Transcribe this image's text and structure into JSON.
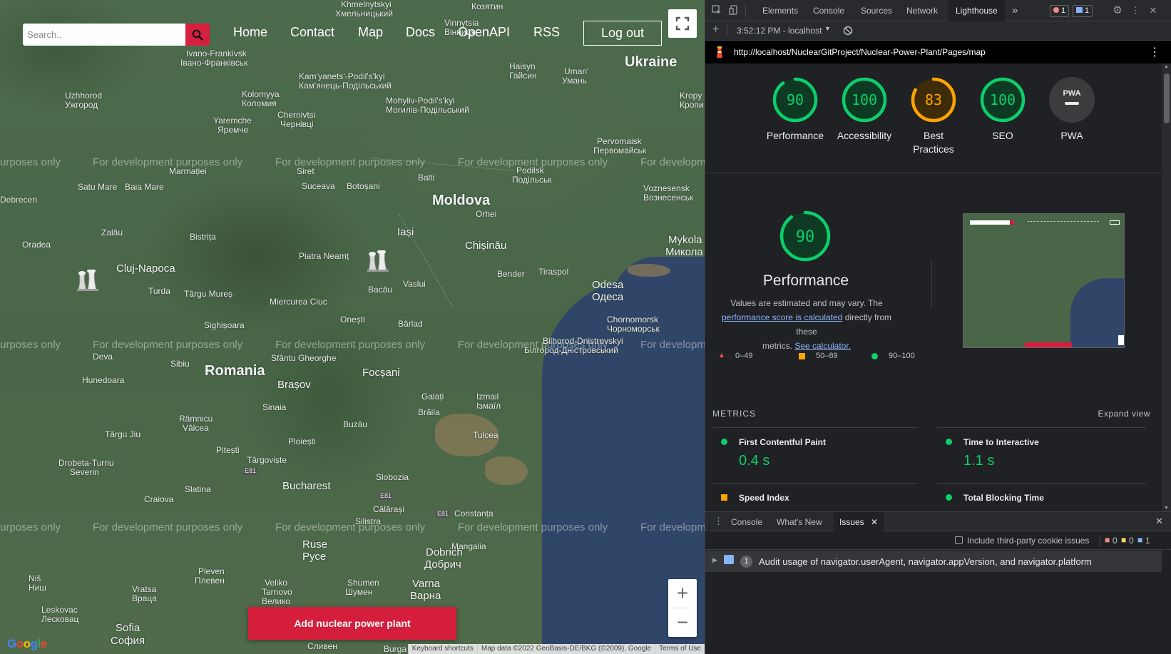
{
  "map": {
    "search_placeholder": "Search..",
    "nav": [
      "Home",
      "Contact",
      "Map",
      "Docs",
      "OpenAPI",
      "RSS"
    ],
    "logout_label": "Log out",
    "add_plant_label": "Add nuclear power plant",
    "watermark": "For development purposes only",
    "watermark_left": "urposes only",
    "watermark_right": "For developm",
    "zoom_in": "+",
    "zoom_out": "−",
    "google": "Google",
    "footer": [
      "Keyboard shortcuts",
      "Map data ©2022 GeoBasis-DE/BKG (©2009), Google",
      "Terms of Use"
    ],
    "labels": {
      "ukraine": "Ukraine",
      "moldova": "Moldova",
      "romania": "Romania",
      "cluj": "Cluj-Napoca",
      "chisinau": "Chișinău",
      "odesa": "Odesa",
      "odesa_cyr": "Одеса",
      "bucharest": "Bucharest",
      "brasov": "Brașov",
      "iasi": "Iași",
      "sofia": "Sofia",
      "sofia_cyr": "София",
      "constanta": "Constanța",
      "varna": "Varna",
      "varna_cyr": "Варна",
      "ivano": "Ivano-Frankivsk",
      "ivano_cyr": "Івано-Франківськ",
      "uzhhorod": "Uzhhorod",
      "uzhhorod_cyr": "Ужгород",
      "chernivtsi": "Chernivtsi",
      "chernivtsi_cyr": "Чернівці",
      "uman": "Uman'",
      "uman_cyr": "Умань",
      "kolomyya": "Kolomyya",
      "kolomyya_cyr": "Коломия",
      "kamyanets": "Kam'yanets'-Podil's'kyi",
      "kamyanets_cyr": "Кам'янець-Подільський",
      "mohyliv": "Mohyliv-Podil's'kyi",
      "mohyliv_cyr": "Могилів-Подільський",
      "khmelnytskyi": "Khmelnytskyi",
      "khmelnytskyi_cyr": "Хмельницький",
      "vinnytsia": "Vinnytsia",
      "vinnytsia_cyr": "Вінниця",
      "kozyatyn": "Козятин",
      "haisyn": "Haisyn",
      "haisyn_cyr": "Гайсин",
      "kropyv": "Kropy",
      "kropyv_cyr": "Кропи",
      "yaremche": "Yaremche",
      "yaremche_cyr": "Яремче",
      "pervomaisk": "Pervomaisk",
      "pervomaisk_cyr": "Первомайськ",
      "podilsk": "Podilsk",
      "podilsk_cyr": "Подільськ",
      "voznesensk": "Voznesensk",
      "voznesensk_cyr": "Вознесенськ",
      "mykola": "Mykola",
      "mykola_cyr": "Микола",
      "balti": "Balti",
      "orhei": "Orhei",
      "bender": "Bender",
      "tiraspol": "Tiraspol",
      "chornomorsk": "Chornomorsk",
      "chornomorsk_cyr": "Чорноморськ",
      "bilhorod": "Bilhorod-Dnistrovskyi",
      "bilhorod_cyr": "Білгород-Дністровський",
      "satu_mare": "Satu Mare",
      "baia_mare": "Baia Mare",
      "debrecen": "Debrecen",
      "marmatiei": "Marmației",
      "siret": "Siret",
      "suceava": "Suceava",
      "botosani": "Botoșani",
      "oradea": "Oradea",
      "zalau": "Zalău",
      "bistrita": "Bistrița",
      "piatra": "Piatra Neamț",
      "bacau": "Bacău",
      "vaslui": "Vaslui",
      "turda": "Turda",
      "targu_mures": "Târgu Mureș",
      "miercurea": "Miercurea Ciuc",
      "sighisoara": "Sighișoara",
      "onesti": "Onești",
      "barlad": "Bârlad",
      "deva": "Deva",
      "sibiu": "Sibiu",
      "sfantu": "Sfântu Gheorghe",
      "focsani": "Focșani",
      "hunedoara": "Hunedoara",
      "galati": "Galați",
      "braila": "Brăila",
      "izmail": "Izmail",
      "izmail_cyr": "Ізмаїл",
      "tulcea": "Tulcea",
      "sinaia": "Sinaia",
      "buzau": "Buzău",
      "ramnicu": "Râmnicu",
      "valcea": "Vâlcea",
      "targu_jiu": "Târgu Jiu",
      "pitesti": "Pitești",
      "ploiesti": "Ploiești",
      "targoviste": "Târgoviște",
      "drobeta": "Drobeta-Turnu",
      "severin": "Severin",
      "slatina": "Slatina",
      "slobozia": "Slobozia",
      "craiova": "Craiova",
      "calarasi": "Călărași",
      "silistra": "Silistra",
      "ruse": "Ruse",
      "ruse_cyr": "Русе",
      "mangalia": "Mangalia",
      "dobrich": "Dobrich",
      "dobrich_cyr": "Добрич",
      "pleven": "Pleven",
      "pleven_cyr": "Плевен",
      "shumen": "Shumen",
      "shumen_cyr": "Шумен",
      "veliko": "Veliko",
      "veliko2": "Tarnovo",
      "veliko_cyr": "Велико",
      "vratsa": "Vratsa",
      "vratsa_cyr": "Враца",
      "leskovac": "Leskovac",
      "leskovac_cyr": "Лесковац",
      "nis": "Niš",
      "nis_cyr": "Ниш",
      "sliven": "Сливен",
      "burgas": "Burga",
      "e81": "E81",
      "e81b": "E81",
      "e81c": "E81"
    }
  },
  "devtools": {
    "tabs": [
      "Elements",
      "Console",
      "Sources",
      "Network",
      "Lighthouse"
    ],
    "more_tabs": "»",
    "error_count": "1",
    "message_count": "1",
    "toolbar_add": "+",
    "report_time": "3:52:12 PM - localhost",
    "url": "http://localhost/NuclearGitProject/Nuclear-Power-Plant/Pages/map",
    "more_icon": "⋮",
    "scores": [
      {
        "label": "Performance",
        "value": "90",
        "score": 0.9,
        "status": "pass"
      },
      {
        "label": "Accessibility",
        "value": "100",
        "score": 1.0,
        "status": "pass"
      },
      {
        "label": "Best Practices",
        "value": "83",
        "score": 0.83,
        "status": "average"
      },
      {
        "label": "SEO",
        "value": "100",
        "score": 1.0,
        "status": "pass"
      },
      {
        "label": "PWA",
        "value": "PWA",
        "score": 0,
        "status": "na"
      }
    ],
    "perf": {
      "value": "90",
      "title": "Performance",
      "desc_1": "Values are estimated and may vary. The",
      "link_1": "performance score is calculated",
      "desc_2": " directly from these",
      "desc_3": "metrics. ",
      "link_2": "See calculator.",
      "legend": [
        "0–49",
        "50–89",
        "90–100"
      ]
    },
    "metrics_title": "METRICS",
    "expand_view": "Expand view",
    "metrics": [
      {
        "name": "First Contentful Paint",
        "value": "0.4 s",
        "status": "pass"
      },
      {
        "name": "Time to Interactive",
        "value": "1.1 s",
        "status": "pass"
      },
      {
        "name": "Speed Index",
        "value": "",
        "status": "average"
      },
      {
        "name": "Total Blocking Time",
        "value": "",
        "status": "pass"
      }
    ],
    "drawer_tabs": [
      "Console",
      "What's New",
      "Issues"
    ],
    "drawer_close": "✕",
    "include_third_party": "Include third-party cookie issues",
    "issue_counts": [
      "0",
      "0",
      "1"
    ],
    "issue_count_badge": "1",
    "issue_text": "Audit usage of navigator.userAgent, navigator.appVersion, and navigator.platform",
    "colors": {
      "pass": "#0cce6b",
      "average": "#ffa400",
      "fail": "#ff4e42",
      "accent": "#d5203f"
    }
  }
}
